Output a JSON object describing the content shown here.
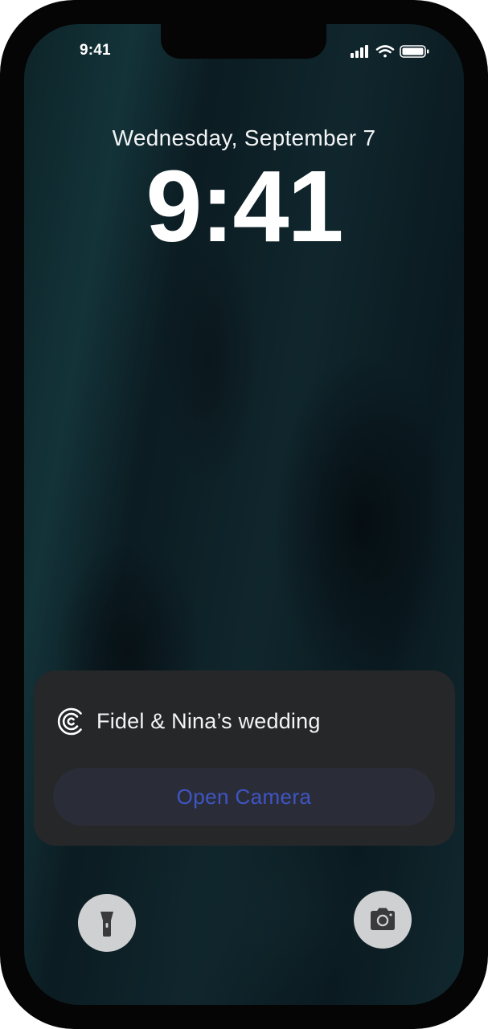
{
  "status_bar": {
    "time": "9:41",
    "icons": [
      "cellular-signal-icon",
      "wifi-icon",
      "battery-icon"
    ]
  },
  "lock_screen": {
    "date": "Wednesday, September 7",
    "time": "9:41"
  },
  "widget": {
    "app_icon": "app-logo-icon",
    "title": "Fidel & Nina’s wedding",
    "button_label": "Open Camera",
    "colors": {
      "background": "#262729",
      "button_background": "#2a2d38",
      "button_text": "#3f55c4"
    }
  },
  "quick_actions": {
    "left": "flashlight-icon",
    "right": "camera-icon"
  }
}
